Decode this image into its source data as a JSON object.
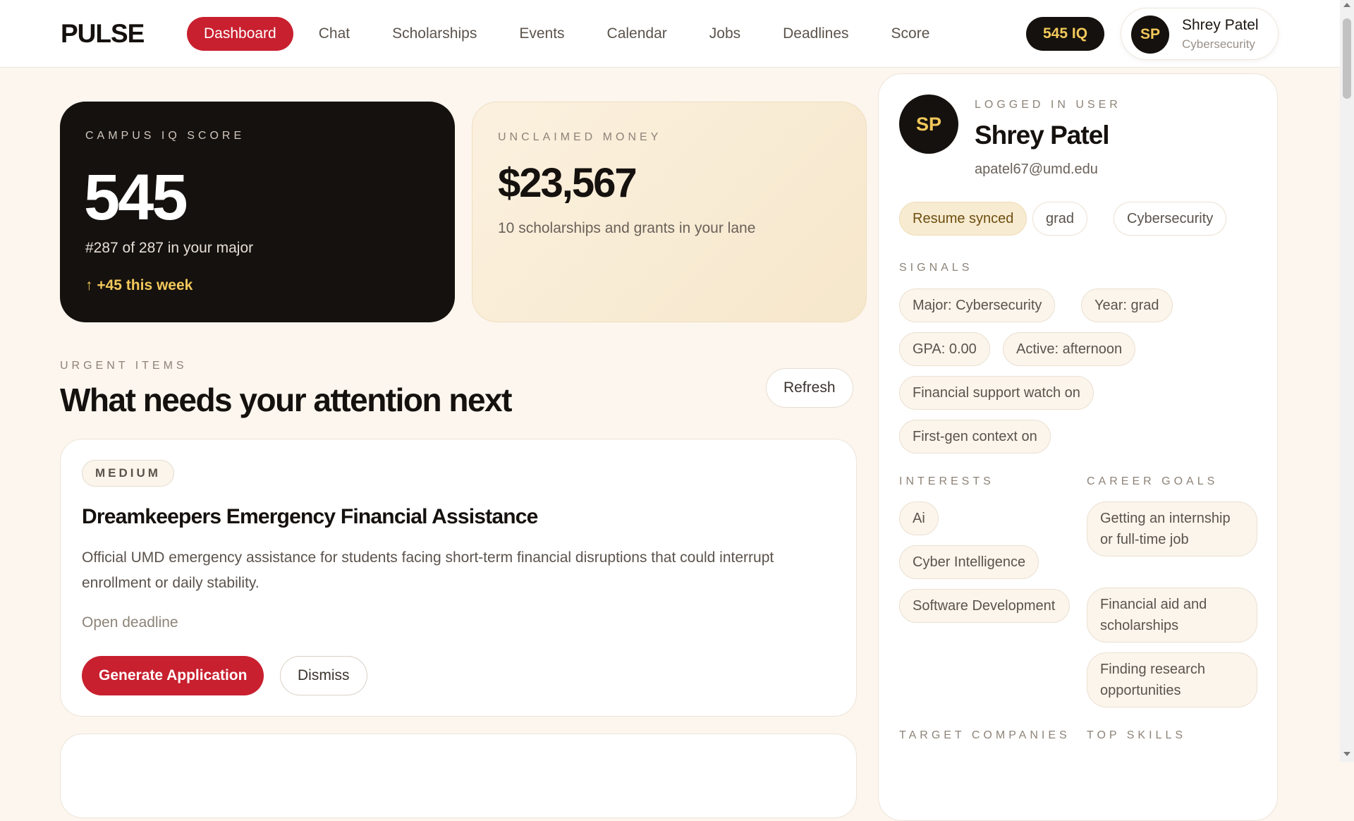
{
  "app": {
    "logo": "PULSE"
  },
  "nav": {
    "links": [
      "Dashboard",
      "Chat",
      "Scholarships",
      "Events",
      "Calendar",
      "Jobs",
      "Deadlines",
      "Score"
    ],
    "iq_pill": "545 IQ",
    "user": {
      "initials": "SP",
      "name": "Shrey Patel",
      "major": "Cybersecurity"
    }
  },
  "score_card": {
    "eyebrow": "CAMPUS IQ SCORE",
    "score": "545",
    "rank": "#287 of 287 in your major",
    "trend": "↑ +45 this week"
  },
  "money_card": {
    "eyebrow": "UNCLAIMED MONEY",
    "amount": "$23,567",
    "sub": "10 scholarships and grants in your lane"
  },
  "urgent": {
    "eyebrow": "URGENT ITEMS",
    "title": "What needs your attention next",
    "refresh_label": "Refresh",
    "items": [
      {
        "badge": "MEDIUM",
        "title": "Dreamkeepers Emergency Financial Assistance",
        "description": "Official UMD emergency assistance for students facing short-term financial disruptions that could interrupt enrollment or daily stability.",
        "deadline": "Open deadline",
        "primary_label": "Generate Application",
        "secondary_label": "Dismiss"
      }
    ]
  },
  "profile": {
    "initials": "SP",
    "logged_label": "LOGGED IN USER",
    "name": "Shrey Patel",
    "email": "apatel67@umd.edu",
    "tags": [
      "Resume synced",
      "grad",
      "Cybersecurity"
    ],
    "signals_label": "SIGNALS",
    "signals": [
      "Major: Cybersecurity",
      "Year: grad",
      "GPA: 0.00",
      "Active: afternoon",
      "Financial support watch on",
      "First-gen context on"
    ],
    "interests_label": "INTERESTS",
    "interests": [
      "Ai",
      "Cyber Intelligence",
      "Software Development"
    ],
    "career_label": "CAREER GOALS",
    "career_goals": [
      "Getting an internship or full-time job",
      "Financial aid and scholarships",
      "Finding research opportunities"
    ],
    "target_label": "TARGET COMPANIES",
    "skills_label": "TOP SKILLS"
  }
}
